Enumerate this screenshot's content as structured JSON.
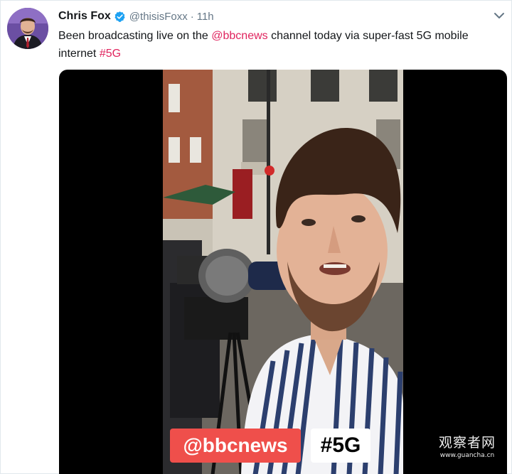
{
  "tweet": {
    "author_name": "Chris Fox",
    "handle": "@thisisFoxx",
    "separator": "·",
    "time": "11h",
    "text_before": "Been broadcasting live on the ",
    "mention": "@bbcnews",
    "text_middle": " channel today via super-fast 5G mobile internet ",
    "hashtag": "#5G",
    "link_color": "#e0245e",
    "verified": true
  },
  "video": {
    "overlay_mention": "@bbcnews",
    "overlay_hashtag": "#5G",
    "mention_badge_color": "#ef4f4b"
  },
  "watermark": {
    "text": "观察者网",
    "url": "www.guancha.cn"
  },
  "icons": {
    "verified": "verified-badge-icon",
    "more": "chevron-down-icon"
  }
}
